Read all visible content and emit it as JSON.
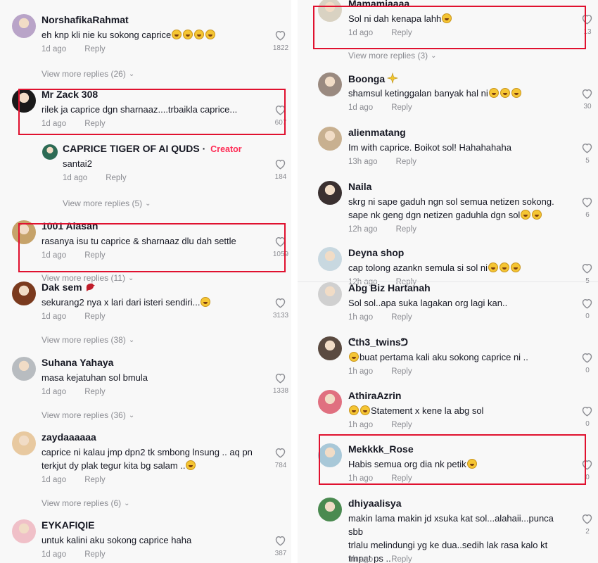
{
  "left": {
    "comments": [
      {
        "username": "NorshafikaRahmat",
        "text": "eh knp kli nie ku sokong caprice",
        "emojis": 4,
        "time": "1d ago",
        "reply": "Reply",
        "likes": "1822",
        "more": "View more replies (26)",
        "avatar_color": "#b9a4c8"
      },
      {
        "username": "Mr Zack 308",
        "text": "rilek ja caprice dgn sharnaaz....trbaikla caprice...",
        "emojis": 0,
        "time": "1d ago",
        "reply": "Reply",
        "likes": "607",
        "avatar_color": "#1a1a1a"
      },
      {
        "username": "CAPRICE TIGER OF AI QUDS",
        "separator": " · ",
        "creator": "Creator",
        "text": "santai2",
        "emojis": 0,
        "time": "1d ago",
        "reply": "Reply",
        "likes": "184",
        "more": "View more replies (5)",
        "avatar_color": "#2d6b55"
      },
      {
        "username": "1001 Alasan",
        "text": "rasanya isu tu caprice & sharnaaz dlu dah settle",
        "emojis": 0,
        "time": "1d ago",
        "reply": "Reply",
        "likes": "1059",
        "more": "View more replies (11)",
        "avatar_color": "#c6a36a"
      },
      {
        "username": "Dak sem",
        "text": "sekurang2 nya x lari dari isteri sendiri...",
        "emojis": 1,
        "time": "1d ago",
        "reply": "Reply",
        "likes": "3133",
        "more": "View more replies (38)",
        "avatar_color": "#7a3a1e"
      },
      {
        "username": "Suhana Yahaya",
        "text": "masa kejatuhan sol bmula",
        "emojis": 0,
        "time": "1d ago",
        "reply": "Reply",
        "likes": "1338",
        "more": "View more replies (36)",
        "avatar_color": "#b8bcc0"
      },
      {
        "username": "zaydaaaaaa",
        "text": "caprice ni kalau jmp dpn2 tk smbong lnsung .. aq pn\nterkjut dy plak tegur kita bg salam ..",
        "emojis": 1,
        "time": "1d ago",
        "reply": "Reply",
        "likes": "784",
        "more": "View more replies (6)",
        "avatar_color": "#e8c9a0"
      },
      {
        "username": "EYKAFIQIE",
        "text": "untuk kalini aku sokong caprice haha",
        "emojis": 0,
        "time": "1d ago",
        "reply": "Reply",
        "likes": "387",
        "avatar_color": "#f0c0c8"
      }
    ]
  },
  "right": {
    "comments": [
      {
        "username": "Mamamiaaaa",
        "text": "Sol ni dah kenapa lahh",
        "emojis": 1,
        "time": "1d ago",
        "reply": "Reply",
        "likes": "13",
        "more": "View more replies (3)",
        "avatar_color": "#d9d2c2"
      },
      {
        "username": "Boonga",
        "text": "shamsul ketinggalan banyak hal ni",
        "emojis": 3,
        "time": "1d ago",
        "reply": "Reply",
        "likes": "30",
        "avatar_color": "#9a8a80"
      },
      {
        "username": "alienmatang",
        "text": "Im with caprice. Boikot sol! Hahahahaha",
        "emojis": 0,
        "time": "13h ago",
        "reply": "Reply",
        "likes": "5",
        "avatar_color": "#c8b090"
      },
      {
        "username": "Naila",
        "text": "skrg ni sape gaduh ngn sol semua netizen sokong.\nsape nk geng dgn netizen gaduhla dgn sol",
        "emojis": 2,
        "time": "12h ago",
        "reply": "Reply",
        "likes": "6",
        "avatar_color": "#3a3030"
      },
      {
        "username": "Deyna shop",
        "text": "cap tolong azankn semula si sol ni",
        "emojis": 3,
        "time": "12h ago",
        "reply": "Reply",
        "likes": "5",
        "avatar_color": "#c8d8e0"
      },
      {
        "username": "Abg Biz Hartanah",
        "text": "Sol sol..apa suka lagakan org lagi kan..",
        "emojis": 0,
        "time": "1h ago",
        "reply": "Reply",
        "likes": "0",
        "avatar_color": "#d0d0d0"
      },
      {
        "username": "ᕦth3_twinsᕤ",
        "text": "buat pertama kali aku sokong caprice ni ..",
        "emojis_pre": 1,
        "emojis": 0,
        "time": "1h ago",
        "reply": "Reply",
        "likes": "0",
        "avatar_color": "#5a4a40"
      },
      {
        "username": "AthiraAzrin",
        "text": "Statement x kene la abg sol",
        "emojis_pre": 2,
        "emojis": 0,
        "time": "1h ago",
        "reply": "Reply",
        "likes": "0",
        "avatar_color": "#e07080"
      },
      {
        "username": "Mekkkk_Rose",
        "text": "Habis semua org dia nk petik",
        "emojis": 1,
        "time": "1h ago",
        "reply": "Reply",
        "likes": "0",
        "avatar_color": "#a8c8d8"
      },
      {
        "username": "dhiyaalisya",
        "text": "makin lama makin jd xsuka kat sol...alahaii...punca sbb\ntrlalu melindungi yg ke dua..sedih lak rasa kalo kt\ntmpat ps ..",
        "emojis": 0,
        "time": "1h ago",
        "reply": "Reply",
        "likes": "2",
        "avatar_color": "#4a8a50"
      }
    ]
  },
  "icons": {
    "like": "heart-outline-icon",
    "expand": "chevron-down-icon",
    "boonga_badge": "sparkle-icon",
    "daksem_badge": "red-bird-icon"
  },
  "colors": {
    "highlight": "#e0112f",
    "creator": "#fe2c55",
    "muted": "#8a8b91"
  }
}
